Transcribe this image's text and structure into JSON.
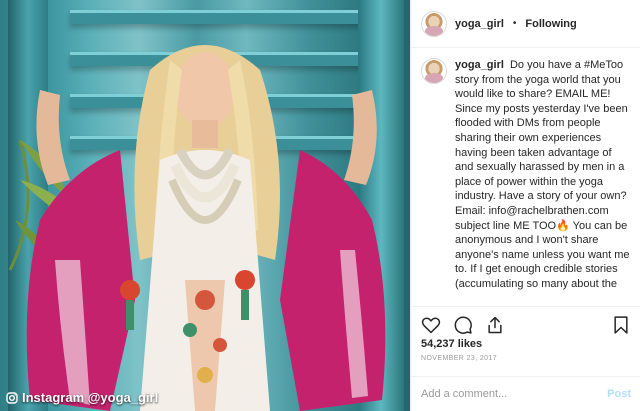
{
  "photo": {
    "caption": "Instagram @yoga_girl",
    "caption_icon": "instagram-camera-icon",
    "colors": {
      "stairs": "#3d96a0",
      "robe_pink": "#c5226e",
      "hair": "#e8cf98",
      "dress": "#f3efe8"
    }
  },
  "post": {
    "username": "yoga_girl",
    "separator": "•",
    "follow_label": "Following",
    "caption_text": "Do you have a #MeToo story from the yoga world that you would like to share? EMAIL ME! Since my posts yesterday I've been flooded with DMs from people sharing their own experiences having been taken advantage of and sexually harassed by men in a place of power within the yoga industry. Have a story of your own? Email: info@rachelbrathen.com subject line ME TOO🔥 You can be anonymous and I won't share anyone's name unless you want me to. If I get enough credible stories (accumulating so many about the same men right now as is) I'll share it as a public blog. So many other industries are outing predators - why is the yoga world so silent?? As of now I have countless stories of I",
    "likes": "54,237 likes",
    "date": "NOVEMBER 23, 2017",
    "comment_placeholder": "Add a comment...",
    "post_label": "Post",
    "icons": [
      "heart-icon",
      "comment-icon",
      "share-icon",
      "bookmark-icon"
    ],
    "colors": {
      "text": "#262626",
      "muted": "#999999",
      "post_button": "#b2dffc",
      "border": "#efefef"
    }
  }
}
